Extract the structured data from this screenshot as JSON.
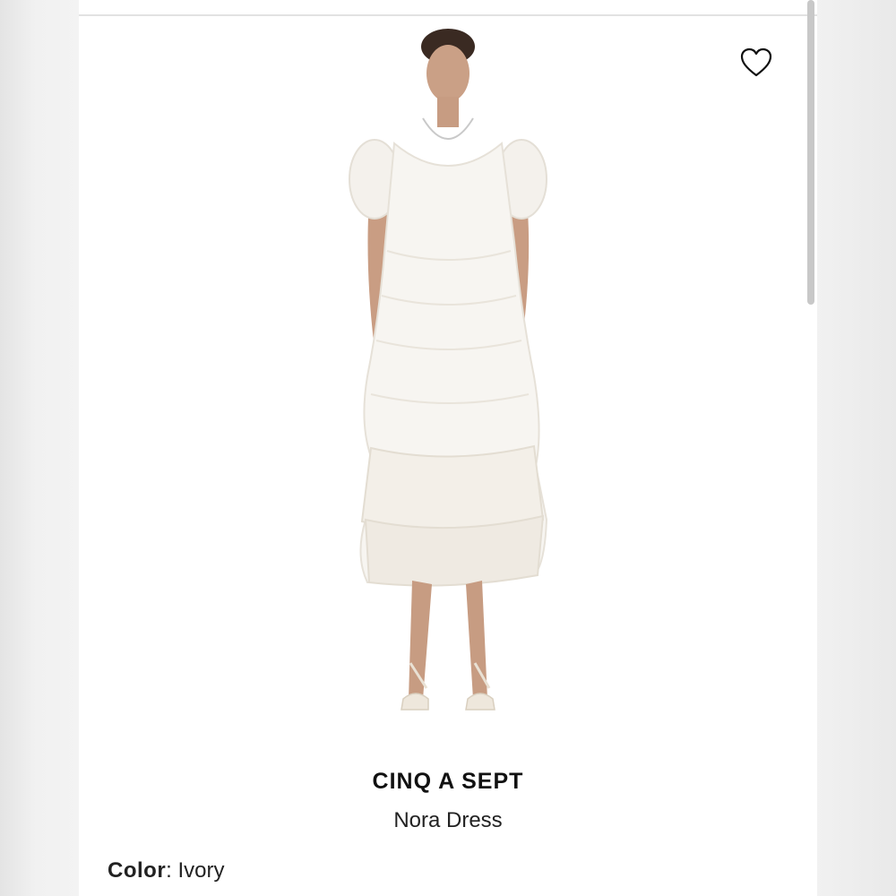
{
  "product": {
    "brand": "CINQ A SEPT",
    "name": "Nora Dress",
    "color_label": "Color",
    "color_separator": ":",
    "color_value": "Ivory",
    "image_icon": "model-wearing-white-dress-photo"
  },
  "actions": {
    "favorite_icon": "heart-outline-icon"
  }
}
